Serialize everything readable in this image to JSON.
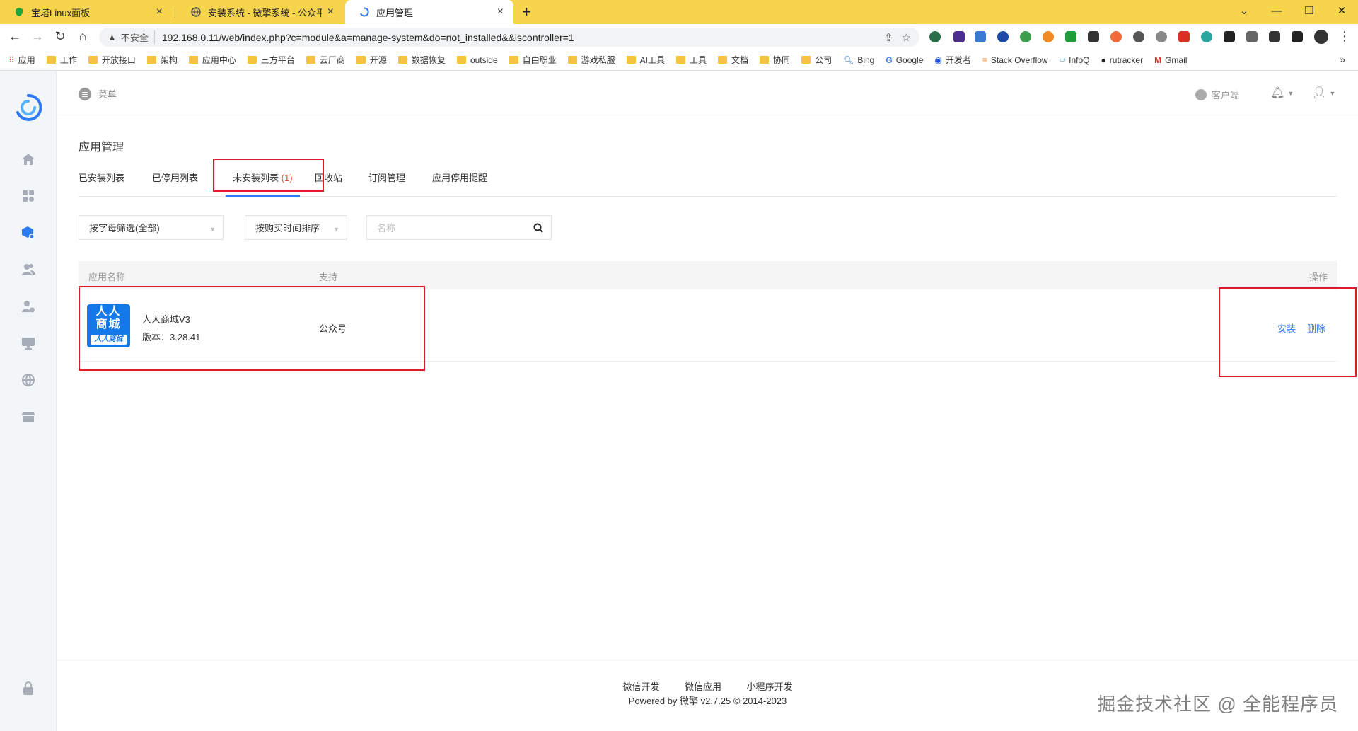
{
  "browser": {
    "tabs": [
      {
        "title": "宝塔Linux面板",
        "color": "#20a53a"
      },
      {
        "title": "安装系统 - 微擎系统 - 公众平台自",
        "color": "#444444"
      },
      {
        "title": "应用管理",
        "color": "#2f7bf5"
      }
    ],
    "new_tab": "+",
    "insecure_label": "不安全",
    "url": "192.168.0.11/web/index.php?c=module&a=manage-system&do=not_installed&&iscontroller=1",
    "bookmarks": [
      {
        "label": "应用",
        "type": "apps"
      },
      {
        "label": "工作",
        "type": "folder"
      },
      {
        "label": "开放接口",
        "type": "folder"
      },
      {
        "label": "架构",
        "type": "folder"
      },
      {
        "label": "应用中心",
        "type": "folder"
      },
      {
        "label": "三方平台",
        "type": "folder"
      },
      {
        "label": "云厂商",
        "type": "folder"
      },
      {
        "label": "开源",
        "type": "folder"
      },
      {
        "label": "数据恢复",
        "type": "folder"
      },
      {
        "label": "outside",
        "type": "folder"
      },
      {
        "label": "自由职业",
        "type": "folder"
      },
      {
        "label": "游戏私服",
        "type": "folder"
      },
      {
        "label": "AI工具",
        "type": "folder"
      },
      {
        "label": "工具",
        "type": "folder"
      },
      {
        "label": "文档",
        "type": "folder"
      },
      {
        "label": "协同",
        "type": "folder"
      },
      {
        "label": "公司",
        "type": "folder"
      },
      {
        "label": "Bing",
        "type": "site"
      },
      {
        "label": "Google",
        "type": "site"
      },
      {
        "label": "开发者",
        "type": "site"
      },
      {
        "label": "Stack Overflow",
        "type": "site"
      },
      {
        "label": "InfoQ",
        "type": "site"
      },
      {
        "label": "rutracker",
        "type": "site"
      },
      {
        "label": "Gmail",
        "type": "site"
      }
    ],
    "bookmarks_more": "»"
  },
  "header": {
    "menu_label": "菜单",
    "client_label": "客户端"
  },
  "page": {
    "title": "应用管理",
    "tabs": [
      {
        "label": "已安装列表"
      },
      {
        "label": "已停用列表"
      },
      {
        "label": "未安装列表",
        "count": "(1)"
      },
      {
        "label": "回收站"
      },
      {
        "label": "订阅管理"
      },
      {
        "label": "应用停用提醒"
      }
    ],
    "filters": {
      "letter": "按字母筛选(全部)",
      "sort": "按购买时间排序",
      "search_placeholder": "名称"
    },
    "table": {
      "headers": {
        "name": "应用名称",
        "support": "支持",
        "action": "操作"
      },
      "rows": [
        {
          "icon_text": [
            "人人",
            "商城",
            "人人商城"
          ],
          "name": "人人商城V3",
          "version": "版本：3.28.41",
          "support": "公众号",
          "install": "安装",
          "delete": "删除"
        }
      ]
    }
  },
  "footer": {
    "links": [
      "微信开发",
      "微信应用",
      "小程序开发"
    ],
    "copyright": "Powered by 微擎 v2.7.25 © 2014-2023"
  },
  "watermark": "掘金技术社区 @ 全能程序员",
  "colors": {
    "accent": "#2f7bf5",
    "highlight": "#e0192b",
    "tabbar": "#f6d54c"
  }
}
